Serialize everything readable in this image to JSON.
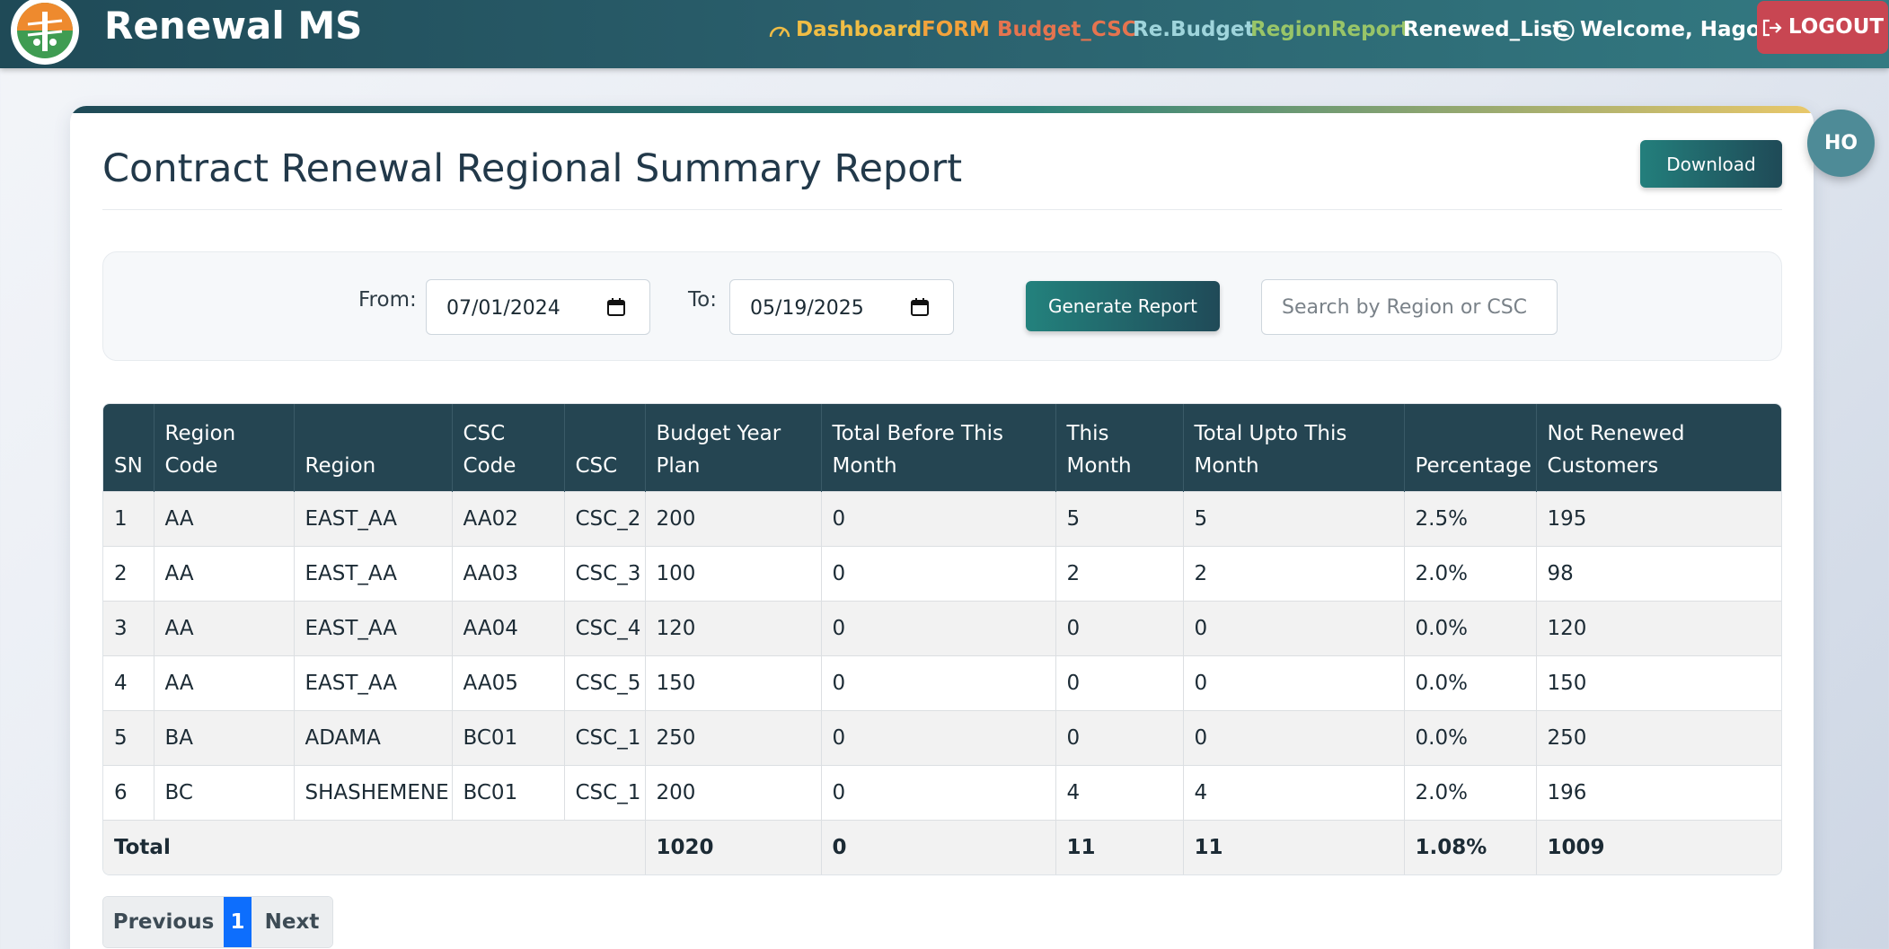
{
  "nav": {
    "brand": "Renewal MS",
    "items": [
      {
        "label": "Dashboard",
        "color": "#f0bd45"
      },
      {
        "label": "FORM",
        "color": "#f2a23c"
      },
      {
        "label": "Budget_CSC",
        "color": "#e5744f"
      },
      {
        "label": "Re.Budget",
        "color": "#9fd5dc"
      },
      {
        "label": "RegionReport",
        "color": "#99c568"
      },
      {
        "label": "Renewed_List",
        "color": "#ffffff"
      }
    ],
    "welcome": "Welcome, Hagos",
    "logout": "LOGOUT"
  },
  "page": {
    "title": "Contract Renewal Regional Summary Report",
    "download_label": "Download",
    "avatar_initials": "HO"
  },
  "filters": {
    "from_label": "From:",
    "from_value": "07/01/2024",
    "to_label": "To:",
    "to_value": "05/19/2025",
    "generate_label": "Generate Report",
    "search_placeholder": "Search by Region or CSC"
  },
  "table": {
    "columns": [
      "SN",
      "Region Code",
      "Region",
      "CSC Code",
      "CSC",
      "Budget Year Plan",
      "Total Before This Month",
      "This Month",
      "Total Upto This Month",
      "Percentage",
      "Not Renewed Customers"
    ],
    "rows": [
      [
        "1",
        "AA",
        "EAST_AA",
        "AA02",
        "CSC_2",
        "200",
        "0",
        "5",
        "5",
        "2.5%",
        "195"
      ],
      [
        "2",
        "AA",
        "EAST_AA",
        "AA03",
        "CSC_3",
        "100",
        "0",
        "2",
        "2",
        "2.0%",
        "98"
      ],
      [
        "3",
        "AA",
        "EAST_AA",
        "AA04",
        "CSC_4",
        "120",
        "0",
        "0",
        "0",
        "0.0%",
        "120"
      ],
      [
        "4",
        "AA",
        "EAST_AA",
        "AA05",
        "CSC_5",
        "150",
        "0",
        "0",
        "0",
        "0.0%",
        "150"
      ],
      [
        "5",
        "BA",
        "ADAMA",
        "BC01",
        "CSC_1",
        "250",
        "0",
        "0",
        "0",
        "0.0%",
        "250"
      ],
      [
        "6",
        "BC",
        "SHASHEMENE",
        "BC01",
        "CSC_1",
        "200",
        "0",
        "4",
        "4",
        "2.0%",
        "196"
      ]
    ],
    "total": {
      "label": "Total",
      "budget": "1020",
      "before": "0",
      "this_month": "11",
      "upto": "11",
      "percentage": "1.08%",
      "not_renewed": "1009"
    }
  },
  "pagination": {
    "previous": "Previous",
    "current": "1",
    "next": "Next"
  }
}
